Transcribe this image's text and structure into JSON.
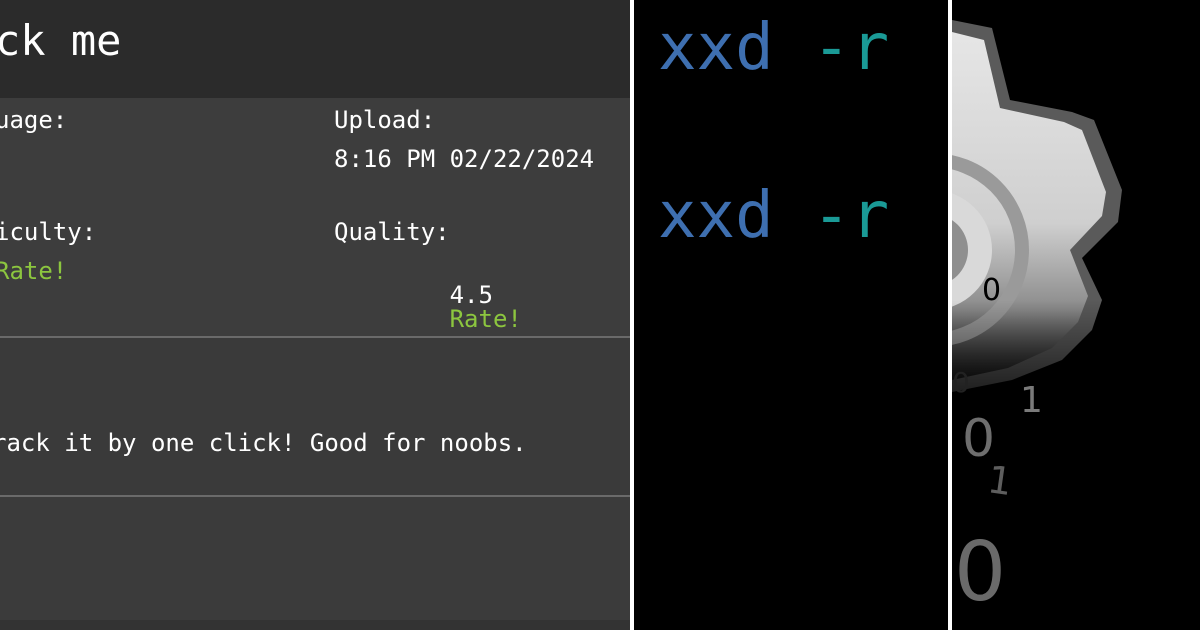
{
  "crackme": {
    "title": "ck me",
    "language_label": "uage:",
    "upload_label": "Upload:",
    "upload_value": "8:16 PM 02/22/2024",
    "difficulty_label": "iculty:",
    "difficulty_rate": "Rate!",
    "quality_label": "Quality:",
    "quality_value": "4.5",
    "quality_rate": "Rate!",
    "description": "rack it by one click! Good for noobs."
  },
  "terminal": {
    "lines": [
      {
        "command": "xxd",
        "flag": "-r"
      },
      {
        "command": "xxd",
        "flag": "-r"
      }
    ]
  },
  "gear_art": {
    "icon": "gear-icon",
    "digits": [
      "0",
      "0",
      "1",
      "0",
      "1",
      "0"
    ]
  },
  "colors": {
    "rate_link": "#8cc63f",
    "terminal_command": "#3e6fb0",
    "terminal_flag": "#1a9a96",
    "panel_bg": "#3a3a3a",
    "title_bg": "#2b2b2b"
  }
}
